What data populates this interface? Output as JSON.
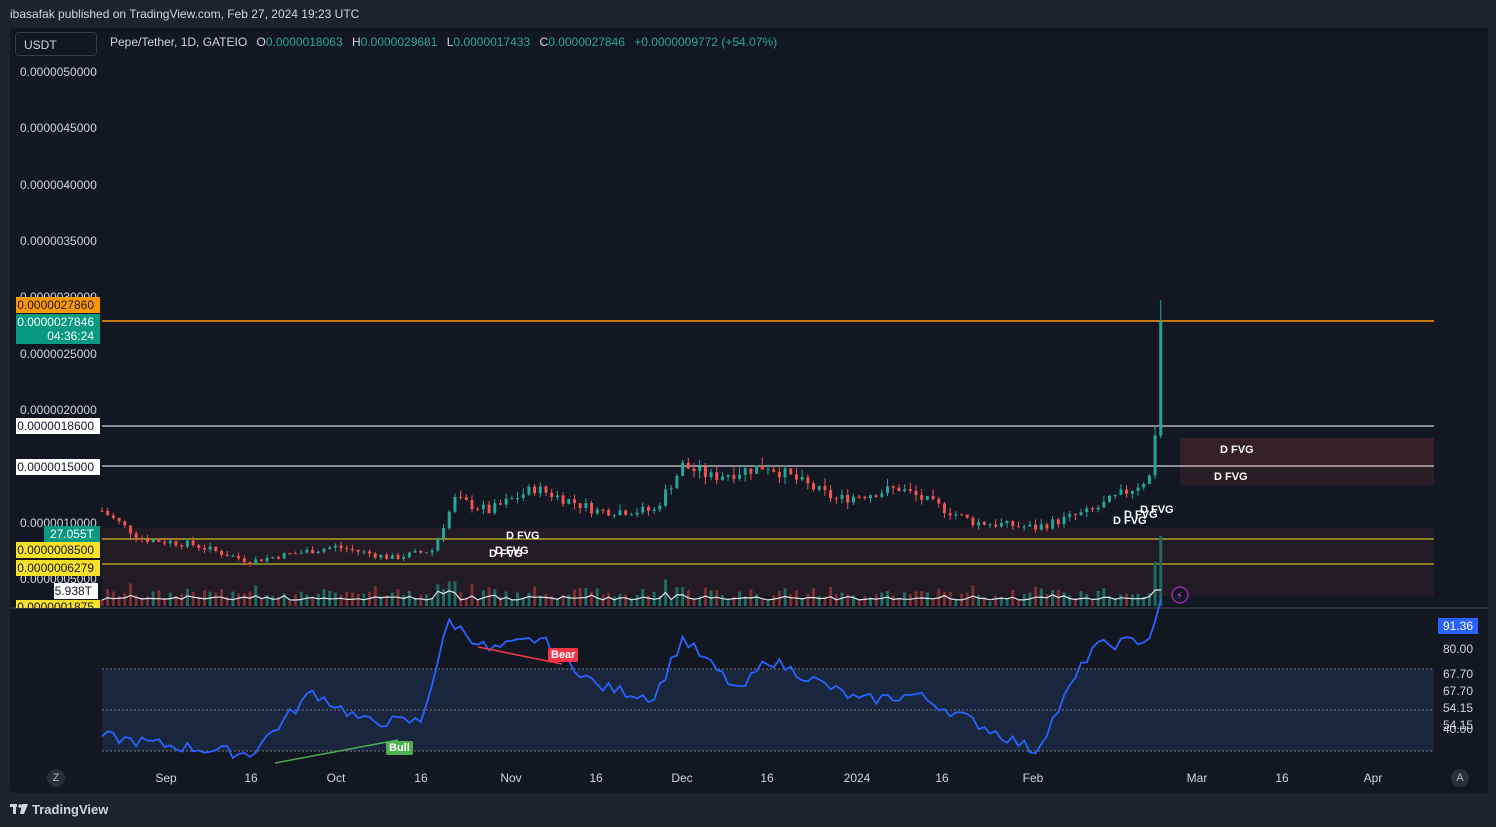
{
  "header": {
    "published": "ibasafak published on TradingView.com, Feb 27, 2024 19:23 UTC"
  },
  "toolbar": {
    "currency": "USDT"
  },
  "legend": {
    "symbol": "Pepe/Tether, 1D, GATEIO",
    "o_label": "O",
    "o": "0.0000018063",
    "h_label": "H",
    "h": "0.0000029681",
    "l_label": "L",
    "l": "0.0000017433",
    "c_label": "C",
    "c": "0.0000027846",
    "change": "+0.0000009772 (+54.07%)"
  },
  "price_axis": [
    "0.0000050000",
    "0.0000045000",
    "0.0000040000",
    "0.0000035000",
    "0.0000025000",
    "0.0000020000",
    "0.0000010000",
    "0.0000005000"
  ],
  "price_axis_hidden": "0.0000030000",
  "tags": {
    "orange": "0.0000027860",
    "last_price": "0.0000027846",
    "countdown": "04:36:24",
    "level_1860": "0.0000018600",
    "level_1500": "0.0000015000",
    "volume_ma": "27.055T",
    "level_0850": "0.0000008500",
    "level_0628": "0.0000006279",
    "volume": "5.938T",
    "level_0188": "0.0000001875"
  },
  "fvg_labels": [
    "D FVG",
    "D FVG",
    "D FVG",
    "D FVG",
    "D FVG",
    "D FVG",
    "D FVG",
    "D FVG"
  ],
  "rsi": {
    "current": "91.36",
    "levels": [
      "80.00",
      "67.70",
      "67.70",
      "54.15",
      "54.15",
      "40.00"
    ],
    "bull_label": "Bull",
    "bear_label": "Bear"
  },
  "time_axis": [
    "Sep",
    "16",
    "Oct",
    "16",
    "Nov",
    "16",
    "Dec",
    "16",
    "2024",
    "16",
    "Feb",
    "Mar",
    "16",
    "Apr"
  ],
  "footer": {
    "brand": "TradingView"
  },
  "corner": {
    "left": "Z",
    "right": "A"
  },
  "colors": {
    "up": "#26a69a",
    "down": "#ef5350",
    "rsi": "#2962ff",
    "orange_line": "#ff9800",
    "yellow_line": "#f9e12a",
    "bull": "#4caf50",
    "bear": "#f23645"
  },
  "chart_data": {
    "type": "candlestick",
    "symbol": "Pepe/Tether",
    "interval": "1D",
    "x_start": "2023-08-25",
    "x_end": "2024-04-15",
    "ylim": [
      0,
      5.5e-06
    ],
    "levels": [
      2.786e-06,
      1.86e-06,
      1.5e-06,
      8.5e-07,
      6.279e-07
    ],
    "close_series": [
      {
        "date": "2023-08-25",
        "close": 1.1e-06
      },
      {
        "date": "2023-09-01",
        "close": 8.5e-07
      },
      {
        "date": "2023-09-10",
        "close": 8e-07
      },
      {
        "date": "2023-09-20",
        "close": 6.5e-07
      },
      {
        "date": "2023-09-25",
        "close": 7e-07
      },
      {
        "date": "2023-10-05",
        "close": 7.8e-07
      },
      {
        "date": "2023-10-15",
        "close": 6.8e-07
      },
      {
        "date": "2023-10-22",
        "close": 7.5e-07
      },
      {
        "date": "2023-10-26",
        "close": 1.2e-06
      },
      {
        "date": "2023-11-01",
        "close": 1.1e-06
      },
      {
        "date": "2023-11-09",
        "close": 1.3e-06
      },
      {
        "date": "2023-11-20",
        "close": 1.1e-06
      },
      {
        "date": "2023-11-30",
        "close": 1.1e-06
      },
      {
        "date": "2023-12-05",
        "close": 1.5e-06
      },
      {
        "date": "2023-12-10",
        "close": 1.4e-06
      },
      {
        "date": "2023-12-20",
        "close": 1.5e-06
      },
      {
        "date": "2024-01-01",
        "close": 1.2e-06
      },
      {
        "date": "2024-01-12",
        "close": 1.3e-06
      },
      {
        "date": "2024-01-25",
        "close": 1e-06
      },
      {
        "date": "2024-02-05",
        "close": 9.5e-07
      },
      {
        "date": "2024-02-15",
        "close": 1.1e-06
      },
      {
        "date": "2024-02-22",
        "close": 1.3e-06
      },
      {
        "date": "2024-02-25",
        "close": 1.4e-06
      },
      {
        "date": "2024-02-26",
        "close": 1.8e-06
      },
      {
        "date": "2024-02-27",
        "close": 2.7846e-06
      }
    ],
    "rsi_series": [
      {
        "date": "2023-08-25",
        "value": 45
      },
      {
        "date": "2023-09-05",
        "value": 42
      },
      {
        "date": "2023-09-20",
        "value": 39
      },
      {
        "date": "2023-10-01",
        "value": 60
      },
      {
        "date": "2023-10-10",
        "value": 50
      },
      {
        "date": "2023-10-20",
        "value": 50
      },
      {
        "date": "2023-10-25",
        "value": 84
      },
      {
        "date": "2023-11-01",
        "value": 74
      },
      {
        "date": "2023-11-10",
        "value": 78
      },
      {
        "date": "2023-11-20",
        "value": 62
      },
      {
        "date": "2023-11-30",
        "value": 58
      },
      {
        "date": "2023-12-05",
        "value": 78
      },
      {
        "date": "2023-12-15",
        "value": 60
      },
      {
        "date": "2023-12-20",
        "value": 71
      },
      {
        "date": "2024-01-05",
        "value": 57
      },
      {
        "date": "2024-01-15",
        "value": 59
      },
      {
        "date": "2024-01-25",
        "value": 50
      },
      {
        "date": "2024-02-05",
        "value": 40
      },
      {
        "date": "2024-02-15",
        "value": 75
      },
      {
        "date": "2024-02-25",
        "value": 78
      },
      {
        "date": "2024-02-27",
        "value": 91.36
      }
    ]
  }
}
